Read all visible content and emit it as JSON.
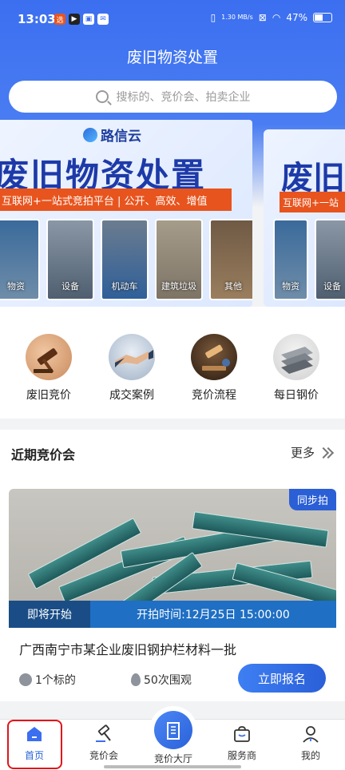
{
  "status": {
    "time": "13:03",
    "net_speed": "1.30 MB/s",
    "battery": "47%"
  },
  "header": {
    "title": "废旧物资处置"
  },
  "search": {
    "placeholder": "搜标的、竞价会、拍卖企业"
  },
  "banner": {
    "brand": "路信云",
    "title": "废旧物资处置",
    "slogan": "互联网+一站式竞拍平台 | 公开、高效、增值",
    "tiles": [
      "物资",
      "设备",
      "机动车",
      "建筑垃圾",
      "其他"
    ]
  },
  "banner2": {
    "title": "废旧",
    "slogan": "互联网+一站",
    "tiles": [
      "物资",
      "设备"
    ]
  },
  "quick_links": [
    {
      "label": "废旧竞价",
      "icon": "gavel-icon"
    },
    {
      "label": "成交案例",
      "icon": "handshake-icon"
    },
    {
      "label": "竞价流程",
      "icon": "auction-process-icon"
    },
    {
      "label": "每日钢价",
      "icon": "steel-plate-icon"
    }
  ],
  "auctions": {
    "title": "近期竞价会",
    "more": "更多",
    "card": {
      "tag": "同步拍",
      "status": "即将开始",
      "start_time": "开拍时间:12月25日 15:00:00",
      "title": "广西南宁市某企业废旧钢护栏材料一批",
      "lots": "1个标的",
      "views": "50次围观",
      "signup": "立即报名"
    }
  },
  "tabbar": {
    "items": [
      {
        "label": "首页",
        "icon": "home-icon"
      },
      {
        "label": "竞价会",
        "icon": "hammer-icon"
      },
      {
        "label": "竞价大厅",
        "icon": "building-icon"
      },
      {
        "label": "服务商",
        "icon": "bag-icon"
      },
      {
        "label": "我的",
        "icon": "user-icon"
      }
    ]
  },
  "colors": {
    "primary": "#3b6ff0",
    "accent_orange": "#e8541e",
    "dark_blue": "#1a4d86",
    "highlight_red": "#e0151b"
  }
}
